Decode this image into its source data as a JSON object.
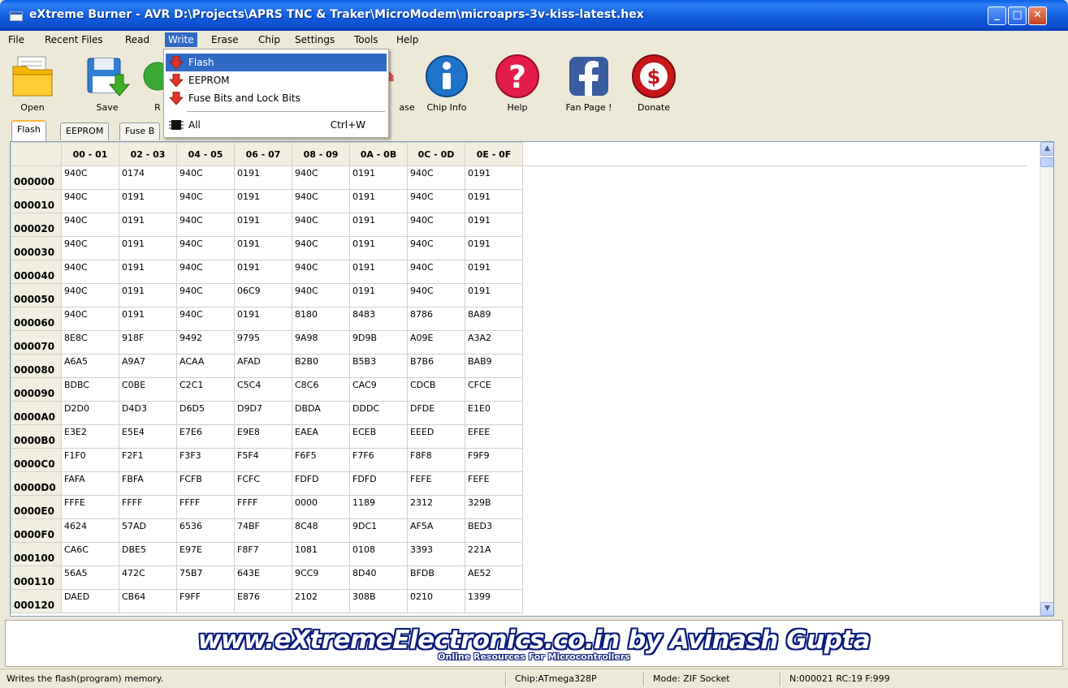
{
  "window": {
    "title": "eXtreme Burner - AVR D:\\Projects\\APRS TNC & Traker\\MicroModem\\microaprs-3v-kiss-latest.hex"
  },
  "menu": [
    "File",
    "Recent Files",
    "Read",
    "Write",
    "Erase",
    "Chip",
    "Settings",
    "Tools",
    "Help"
  ],
  "toolbar": {
    "open": "Open",
    "save": "Save",
    "read": "R",
    "erase": "ase",
    "chip_info": "Chip Info",
    "help": "Help",
    "fan_page": "Fan Page !",
    "donate": "Donate"
  },
  "write_menu": {
    "flash": "Flash",
    "eeprom": "EEPROM",
    "fuse": "Fuse Bits and Lock Bits",
    "all": "All",
    "all_shortcut": "Ctrl+W"
  },
  "tabs": {
    "flash": "Flash",
    "eeprom": "EEPROM",
    "fuse": "Fuse B"
  },
  "grid": {
    "columns": [
      "00 - 01",
      "02 - 03",
      "04 - 05",
      "06 - 07",
      "08 - 09",
      "0A - 0B",
      "0C - 0D",
      "0E - 0F"
    ],
    "rows": [
      {
        "addr": "000000",
        "cells": [
          "940C",
          "0174",
          "940C",
          "0191",
          "940C",
          "0191",
          "940C",
          "0191"
        ]
      },
      {
        "addr": "000010",
        "cells": [
          "940C",
          "0191",
          "940C",
          "0191",
          "940C",
          "0191",
          "940C",
          "0191"
        ]
      },
      {
        "addr": "000020",
        "cells": [
          "940C",
          "0191",
          "940C",
          "0191",
          "940C",
          "0191",
          "940C",
          "0191"
        ]
      },
      {
        "addr": "000030",
        "cells": [
          "940C",
          "0191",
          "940C",
          "0191",
          "940C",
          "0191",
          "940C",
          "0191"
        ]
      },
      {
        "addr": "000040",
        "cells": [
          "940C",
          "0191",
          "940C",
          "0191",
          "940C",
          "0191",
          "940C",
          "0191"
        ]
      },
      {
        "addr": "000050",
        "cells": [
          "940C",
          "0191",
          "940C",
          "06C9",
          "940C",
          "0191",
          "940C",
          "0191"
        ]
      },
      {
        "addr": "000060",
        "cells": [
          "940C",
          "0191",
          "940C",
          "0191",
          "8180",
          "8483",
          "8786",
          "8A89"
        ]
      },
      {
        "addr": "000070",
        "cells": [
          "8E8C",
          "918F",
          "9492",
          "9795",
          "9A98",
          "9D9B",
          "A09E",
          "A3A2"
        ]
      },
      {
        "addr": "000080",
        "cells": [
          "A6A5",
          "A9A7",
          "ACAA",
          "AFAD",
          "B2B0",
          "B5B3",
          "B7B6",
          "BAB9"
        ]
      },
      {
        "addr": "000090",
        "cells": [
          "BDBC",
          "C0BE",
          "C2C1",
          "C5C4",
          "C8C6",
          "CAC9",
          "CDCB",
          "CFCE"
        ]
      },
      {
        "addr": "0000A0",
        "cells": [
          "D2D0",
          "D4D3",
          "D6D5",
          "D9D7",
          "DBDA",
          "DDDC",
          "DFDE",
          "E1E0"
        ]
      },
      {
        "addr": "0000B0",
        "cells": [
          "E3E2",
          "E5E4",
          "E7E6",
          "E9E8",
          "EAEA",
          "ECEB",
          "EEED",
          "EFEE"
        ]
      },
      {
        "addr": "0000C0",
        "cells": [
          "F1F0",
          "F2F1",
          "F3F3",
          "F5F4",
          "F6F5",
          "F7F6",
          "F8F8",
          "F9F9"
        ]
      },
      {
        "addr": "0000D0",
        "cells": [
          "FAFA",
          "FBFA",
          "FCFB",
          "FCFC",
          "FDFD",
          "FDFD",
          "FEFE",
          "FEFE"
        ]
      },
      {
        "addr": "0000E0",
        "cells": [
          "FFFE",
          "FFFF",
          "FFFF",
          "FFFF",
          "0000",
          "1189",
          "2312",
          "329B"
        ]
      },
      {
        "addr": "0000F0",
        "cells": [
          "4624",
          "57AD",
          "6536",
          "74BF",
          "8C48",
          "9DC1",
          "AF5A",
          "BED3"
        ]
      },
      {
        "addr": "000100",
        "cells": [
          "CA6C",
          "DBE5",
          "E97E",
          "F8F7",
          "1081",
          "0108",
          "3393",
          "221A"
        ]
      },
      {
        "addr": "000110",
        "cells": [
          "56A5",
          "472C",
          "75B7",
          "643E",
          "9CC9",
          "8D40",
          "BFDB",
          "AE52"
        ]
      },
      {
        "addr": "000120",
        "cells": [
          "DAED",
          "CB64",
          "F9FF",
          "E876",
          "2102",
          "308B",
          "0210",
          "1399"
        ]
      }
    ]
  },
  "banner": {
    "main": "www.eXtremeElectronics.co.in by Avinash Gupta",
    "sub": "Online Resources For Microcontrollers"
  },
  "status": {
    "message": "Writes the flash(program) memory.",
    "chip": "Chip:ATmega328P",
    "mode": "Mode: ZIF Socket",
    "counter": "N:000021 RC:19 F:999"
  }
}
